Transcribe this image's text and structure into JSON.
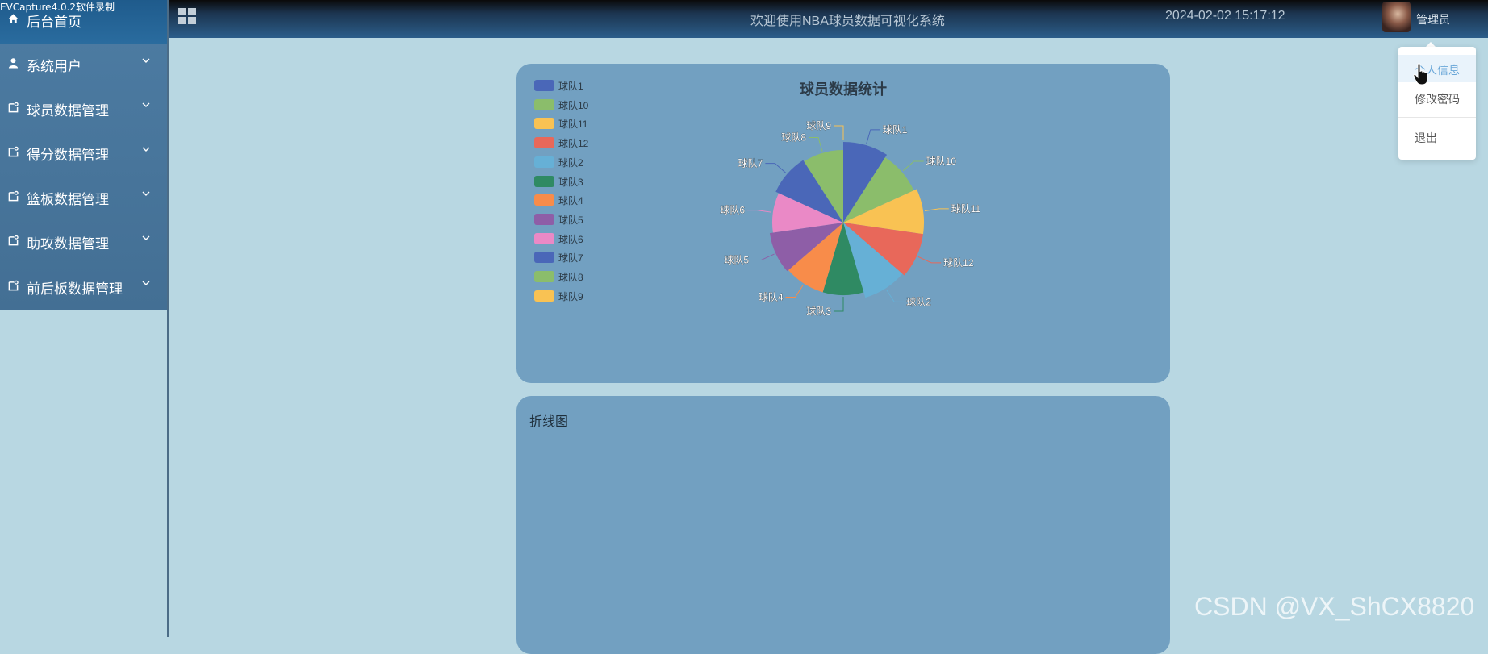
{
  "recorder_overlay": "EVCapture4.0.2软件录制",
  "header": {
    "title": "欢迎使用NBA球员数据可视化系统",
    "datetime": "2024-02-02 15:17:12",
    "username": "管理员"
  },
  "sidebar": {
    "home": "后台首页",
    "items": [
      {
        "label": "系统用户",
        "icon": "user-icon"
      },
      {
        "label": "球员数据管理",
        "icon": "doc-icon"
      },
      {
        "label": "得分数据管理",
        "icon": "doc-icon"
      },
      {
        "label": "篮板数据管理",
        "icon": "doc-icon"
      },
      {
        "label": "助攻数据管理",
        "icon": "doc-icon"
      },
      {
        "label": "前后板数据管理",
        "icon": "doc-icon"
      }
    ]
  },
  "dropdown": {
    "items": [
      "个人信息",
      "修改密码",
      "退出"
    ]
  },
  "line_panel": {
    "title": "折线图"
  },
  "watermark": "CSDN @VX_ShCX8820",
  "chart_data": {
    "type": "pie",
    "title": "球员数据统计",
    "legend_position": "top-left",
    "slices": [
      {
        "label": "球队1",
        "value": 100,
        "color": "#4a67b8"
      },
      {
        "label": "球队10",
        "value": 100,
        "color": "#8bbd6b"
      },
      {
        "label": "球队11",
        "value": 100,
        "color": "#f9c253"
      },
      {
        "label": "球队12",
        "value": 100,
        "color": "#e8685a"
      },
      {
        "label": "球队2",
        "value": 100,
        "color": "#66b0d6"
      },
      {
        "label": "球队3",
        "value": 100,
        "color": "#2f8a63"
      },
      {
        "label": "球队4",
        "value": 100,
        "color": "#f88c4a"
      },
      {
        "label": "球队5",
        "value": 100,
        "color": "#8e5ea7"
      },
      {
        "label": "球队6",
        "value": 100,
        "color": "#ea89c6"
      },
      {
        "label": "球队7",
        "value": 100,
        "color": "#4a67b8"
      },
      {
        "label": "球队8",
        "value": 100,
        "color": "#8bbd6b"
      },
      {
        "label": "球队9",
        "value": 0,
        "color": "#f9c253"
      }
    ]
  }
}
